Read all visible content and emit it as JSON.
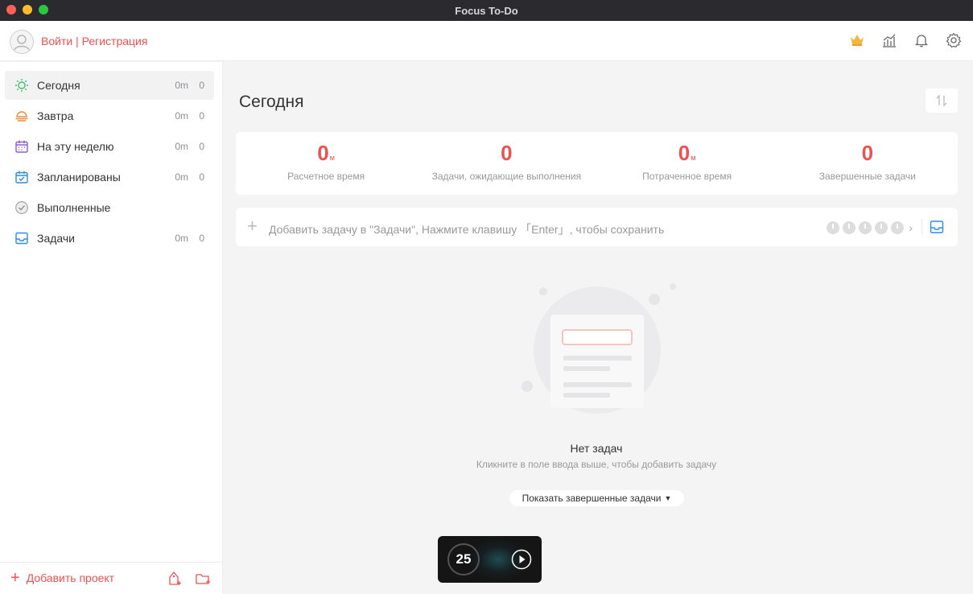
{
  "window": {
    "title": "Focus To-Do"
  },
  "header": {
    "login_label": "Войти | Регистрация",
    "icons": [
      "crown-icon",
      "statistics-icon",
      "bell-icon",
      "gear-icon"
    ]
  },
  "sidebar": {
    "items": [
      {
        "label": "Сегодня",
        "time": "0m",
        "count": "0",
        "icon": "sun-icon",
        "active": true
      },
      {
        "label": "Завтра",
        "time": "0m",
        "count": "0",
        "icon": "sunrise-icon"
      },
      {
        "label": "На эту неделю",
        "time": "0m",
        "count": "0",
        "icon": "calendar-week-icon"
      },
      {
        "label": "Запланированы",
        "time": "0m",
        "count": "0",
        "icon": "calendar-check-icon"
      },
      {
        "label": "Выполненные",
        "time": "",
        "count": "",
        "icon": "check-circle-icon"
      },
      {
        "label": "Задачи",
        "time": "0m",
        "count": "0",
        "icon": "inbox-icon"
      }
    ],
    "add_project_label": "Добавить проект"
  },
  "main": {
    "title": "Сегодня",
    "stats": [
      {
        "value": "0",
        "unit": "м",
        "label": "Расчетное время"
      },
      {
        "value": "0",
        "unit": "",
        "label": "Задачи, ожидающие выполнения"
      },
      {
        "value": "0",
        "unit": "м",
        "label": "Потраченное время"
      },
      {
        "value": "0",
        "unit": "",
        "label": "Завершенные задачи"
      }
    ],
    "add_task_placeholder": "Добавить задачу в \"Задачи\", Нажмите клавишу 「Enter」, чтобы сохранить",
    "empty_title": "Нет задач",
    "empty_subtitle": "Кликните в поле ввода выше, чтобы добавить задачу",
    "show_completed_label": "Показать завершенные задачи"
  },
  "timer": {
    "minutes": "25"
  },
  "colors": {
    "accent": "#f0504f",
    "today_icon": "#3dbb6c",
    "tomorrow_icon": "#f08a3c",
    "week_icon": "#8e5bd6",
    "planned_icon": "#2d8cf0",
    "inbox_icon": "#2d8cf0"
  }
}
